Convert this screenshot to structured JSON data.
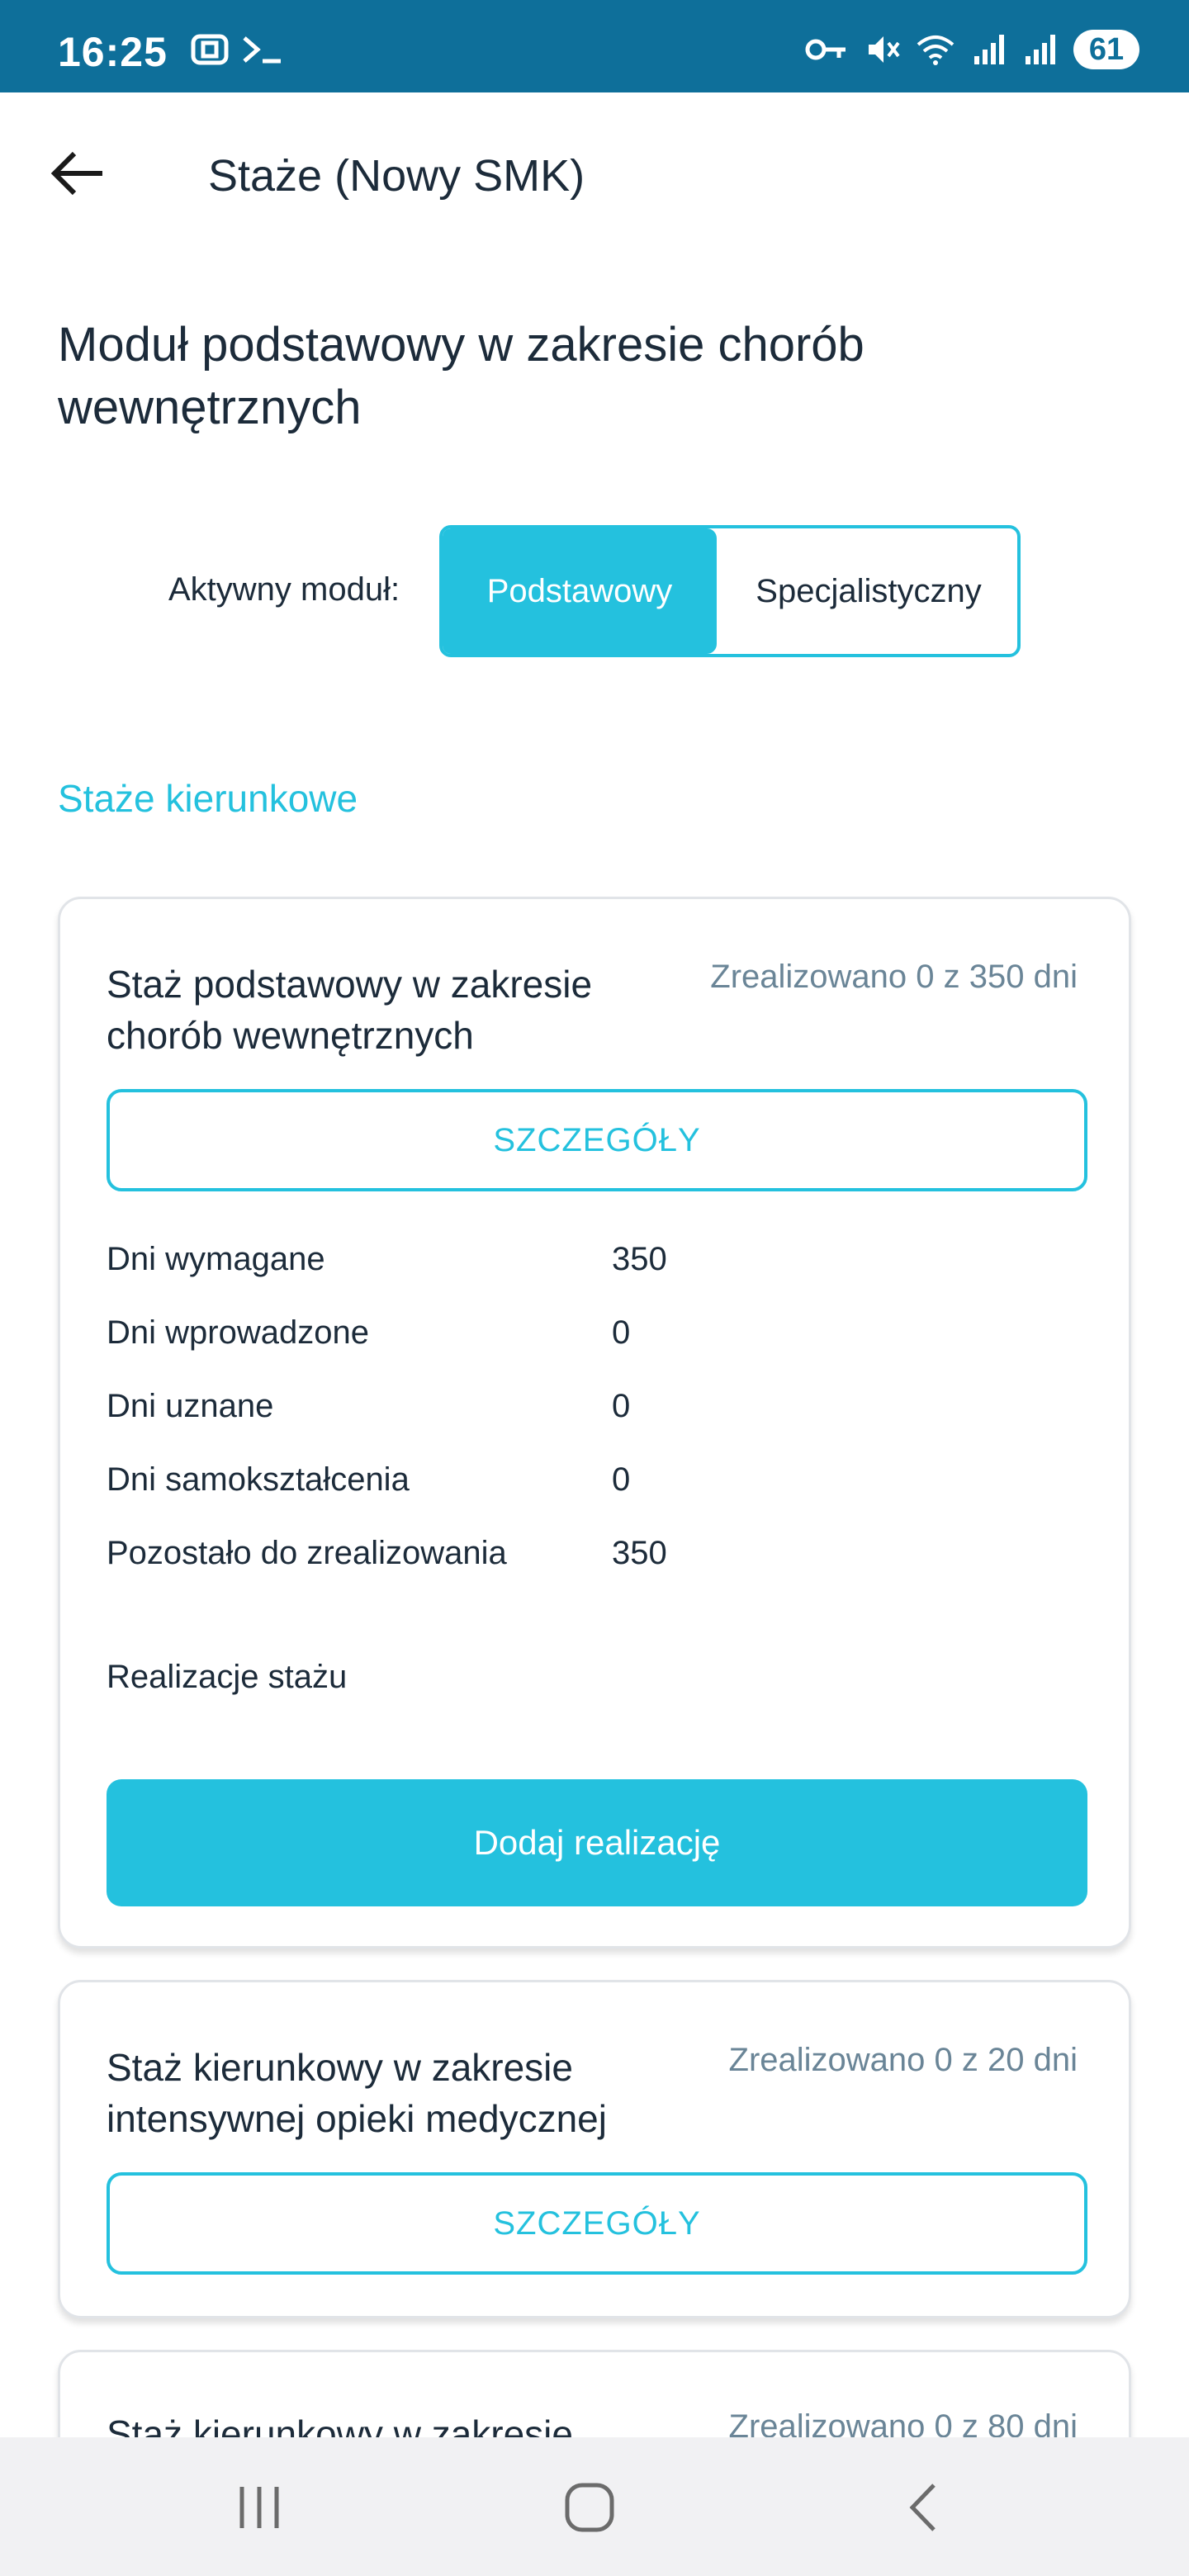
{
  "status_bar": {
    "time": "16:25",
    "battery": "61",
    "colors": {
      "background": "#0e6f9a"
    }
  },
  "app_bar": {
    "title": "Staże (Nowy SMK)"
  },
  "module": {
    "title": "Moduł podstawowy w zakresie chorób wewnętrznych",
    "active_label": "Aktywny moduł:",
    "options": [
      "Podstawowy",
      "Specjalistyczny"
    ],
    "selected": "Podstawowy"
  },
  "section": {
    "title": "Staże kierunkowe"
  },
  "cards": [
    {
      "title": "Staż podstawowy w zakresie chorób wewnętrznych",
      "status": "Zrealizowano 0 z 350 dni",
      "details_label": "SZCZEGÓŁY",
      "stats": [
        {
          "label": "Dni wymagane",
          "value": "350"
        },
        {
          "label": "Dni wprowadzone",
          "value": "0"
        },
        {
          "label": "Dni uznane",
          "value": "0"
        },
        {
          "label": "Dni samokształcenia",
          "value": "0"
        },
        {
          "label": "Pozostało do zrealizowania",
          "value": "350"
        }
      ],
      "realizations_label": "Realizacje stażu",
      "add_label": "Dodaj realizację"
    },
    {
      "title": "Staż kierunkowy w zakresie intensywnej opieki medycznej",
      "status": "Zrealizowano 0 z 20 dni",
      "details_label": "SZCZEGÓŁY"
    },
    {
      "title": "Staż kierunkowy w zakresie",
      "status": "Zrealizowano 0 z 80 dni"
    }
  ],
  "colors": {
    "accent": "#24c1de",
    "text": "#1c2b3a",
    "muted": "#6a8597"
  },
  "icons": {
    "back": "arrow-left-icon",
    "nav_recents": "recents-icon",
    "nav_home": "home-icon",
    "nav_back": "nav-back-icon"
  }
}
